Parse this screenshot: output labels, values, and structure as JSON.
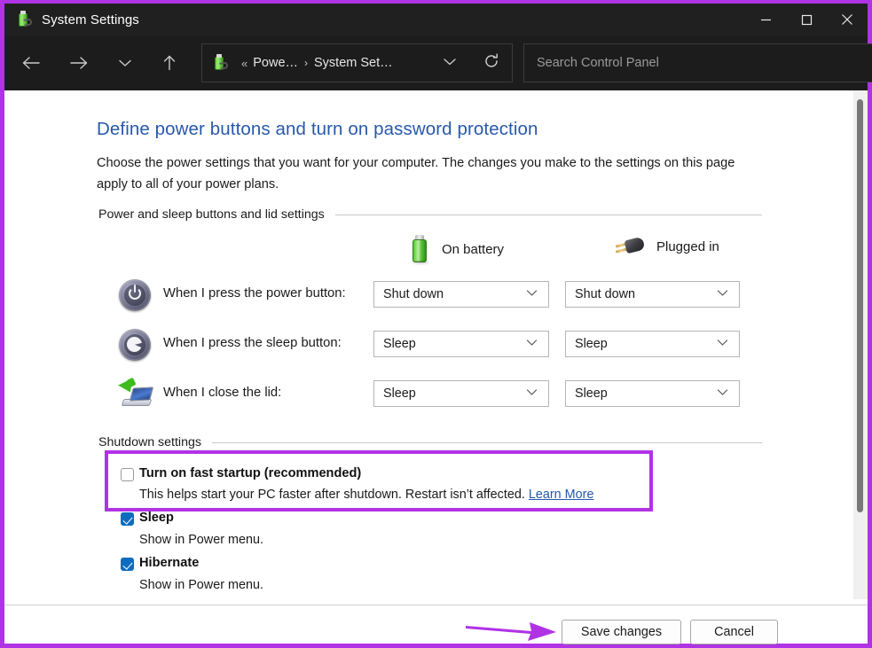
{
  "window": {
    "title": "System Settings",
    "app_icon": "power-battery-icon",
    "controls": {
      "minimize": "minimize-icon",
      "maximize": "maximize-icon",
      "close": "close-icon"
    }
  },
  "navbar": {
    "back": "back-arrow-icon",
    "forward": "forward-arrow-icon",
    "history": "recent-locations-icon",
    "up": "up-arrow-icon",
    "address": {
      "icon": "power-battery-icon",
      "overflow": "«",
      "crumbs": [
        "Powe…",
        "System Set…"
      ],
      "separator": "›",
      "dropdown": "chevron-down-icon",
      "refresh": "refresh-icon"
    },
    "search": {
      "placeholder": "Search Control Panel",
      "icon": "search-icon"
    }
  },
  "page": {
    "title": "Define power buttons and turn on password protection",
    "description": "Choose the power settings that you want for your computer. The changes you make to the settings on this page apply to all of your power plans."
  },
  "sections": {
    "power_sleep": {
      "heading": "Power and sleep buttons and lid settings",
      "columns": [
        {
          "label": "On battery",
          "icon": "battery-icon"
        },
        {
          "label": "Plugged in",
          "icon": "power-plug-icon"
        }
      ],
      "rows": [
        {
          "icon": "power-button-icon",
          "label": "When I press the power button:",
          "on_battery": "Shut down",
          "plugged_in": "Shut down"
        },
        {
          "icon": "sleep-button-icon",
          "label": "When I press the sleep button:",
          "on_battery": "Sleep",
          "plugged_in": "Sleep"
        },
        {
          "icon": "laptop-lid-icon",
          "label": "When I close the lid:",
          "on_battery": "Sleep",
          "plugged_in": "Sleep"
        }
      ]
    },
    "shutdown": {
      "heading": "Shutdown settings",
      "options": [
        {
          "title": "Turn on fast startup (recommended)",
          "checked": false,
          "description": "This helps start your PC faster after shutdown. Restart isn’t affected.",
          "link": "Learn More",
          "highlighted": true
        },
        {
          "title": "Sleep",
          "checked": true,
          "description": "Show in Power menu.",
          "link": "",
          "highlighted": false
        },
        {
          "title": "Hibernate",
          "checked": true,
          "description": "Show in Power menu.",
          "link": "",
          "highlighted": false
        }
      ]
    }
  },
  "footer": {
    "save_label": "Save changes",
    "cancel_label": "Cancel"
  },
  "annotations": {
    "accent_color": "#b033e6",
    "arrow": "pointer-arrow-to-save-changes",
    "highlight": "fast-startup-highlight-rect"
  },
  "colors": {
    "link": "#2759ab",
    "checkbox_checked": "#0f6cbd",
    "titlebar_bg": "#202020",
    "navbar_bg": "#1c1c1c"
  }
}
